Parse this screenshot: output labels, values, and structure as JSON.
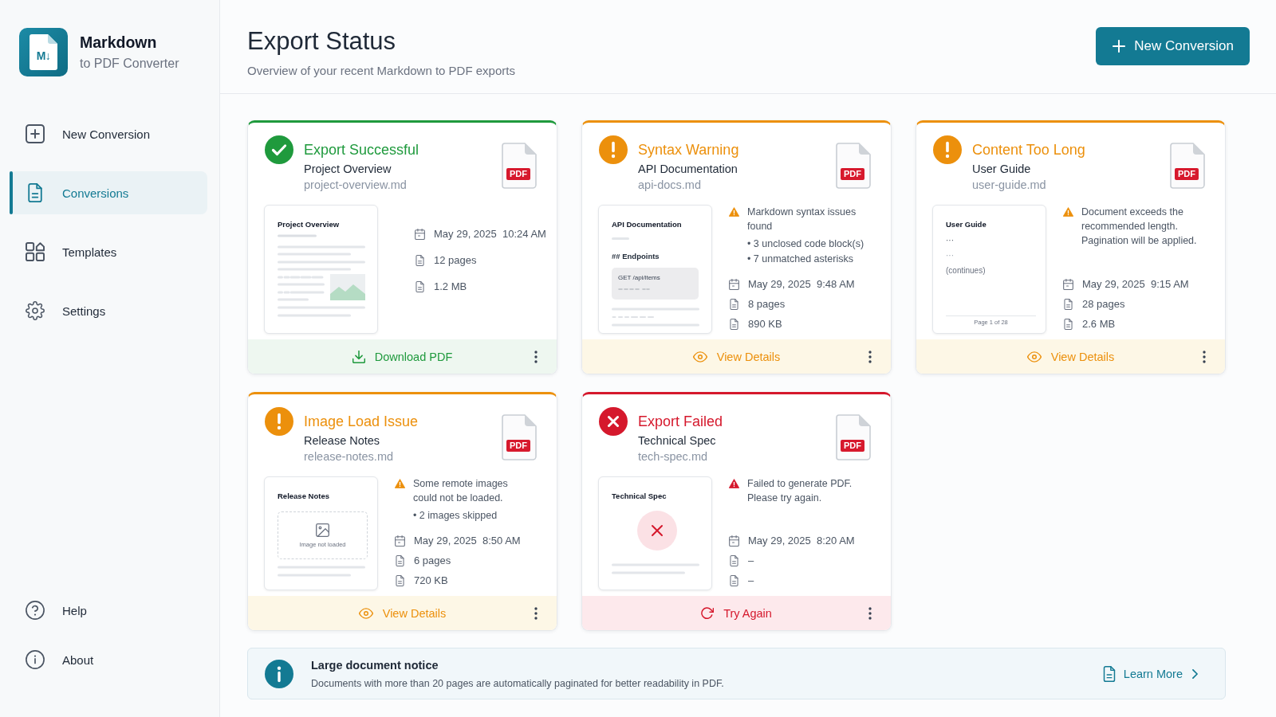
{
  "sidebar": {
    "logo_mark": "M↓",
    "app_title": "Markdown",
    "app_subtitle": "to PDF Converter",
    "nav_items": [
      {
        "label": "New Conversion",
        "selected": false
      },
      {
        "label": "Conversions",
        "selected": true
      },
      {
        "label": "Templates",
        "selected": false
      },
      {
        "label": "Settings",
        "selected": false
      }
    ],
    "footer_items": [
      {
        "label": "Help"
      },
      {
        "label": "About"
      }
    ]
  },
  "header": {
    "title": "Export Status",
    "subtitle": "Overview of your recent Markdown to PDF exports",
    "new_button": "New Conversion"
  },
  "cards": [
    {
      "kind": "success",
      "status": "Export Successful",
      "document": "Project Overview",
      "file": "project-overview.md",
      "file_type": "PDF",
      "preview": {
        "kind": "article",
        "title": "Project Overview"
      },
      "meta": {
        "date": "May 29, 2025  10:24 AM",
        "pages": "12 pages",
        "size": "1.2 MB"
      },
      "action": "Download PDF"
    },
    {
      "kind": "warning",
      "status": "Syntax Warning",
      "document": "API Documentation",
      "file": "api-docs.md",
      "file_type": "PDF",
      "preview": {
        "kind": "code",
        "title": "API Documentation",
        "heading": "## Endpoints",
        "code": "GET /api/items"
      },
      "message": {
        "text": "Markdown syntax issues found",
        "bullets": [
          "• 3 unclosed code block(s)",
          "• 7 unmatched asterisks"
        ]
      },
      "meta": {
        "date": "May 29, 2025  9:48 AM",
        "pages": "8 pages",
        "size": "890 KB"
      },
      "action": "View Details"
    },
    {
      "kind": "warning",
      "status": "Content Too Long",
      "document": "User Guide",
      "file": "user-guide.md",
      "file_type": "PDF",
      "preview": {
        "kind": "long",
        "title": "User Guide",
        "lines": [
          "···",
          "···",
          "(continues)"
        ],
        "page_label": "Page 1 of 28"
      },
      "message": {
        "text": "Document exceeds the recommended length. Pagination will be applied."
      },
      "meta": {
        "date": "May 29, 2025  9:15 AM",
        "pages": "28 pages",
        "size": "2.6 MB"
      },
      "action": "View Details"
    },
    {
      "kind": "warning",
      "status": "Image Load Issue",
      "document": "Release Notes",
      "file": "release-notes.md",
      "file_type": "PDF",
      "preview": {
        "kind": "missing_image",
        "title": "Release Notes",
        "caption": "Image not loaded"
      },
      "message": {
        "text": "Some remote images could not be loaded.",
        "bullets": [
          "• 2 images skipped"
        ]
      },
      "meta": {
        "date": "May 29, 2025  8:50 AM",
        "pages": "6 pages",
        "size": "720 KB"
      },
      "action": "View Details"
    },
    {
      "kind": "error",
      "status": "Export Failed",
      "document": "Technical Spec",
      "file": "tech-spec.md",
      "file_type": "PDF",
      "preview": {
        "kind": "failed",
        "title": "Technical Spec"
      },
      "message": {
        "text": "Failed to generate PDF. Please try again."
      },
      "meta": {
        "date": "May 29, 2025  8:20 AM",
        "pages": "–",
        "size": "–"
      },
      "action": "Try Again"
    }
  ],
  "notice": {
    "title": "Large document notice",
    "text": "Documents with more than 20 pages are automatically paginated for better readability in PDF.",
    "link": "Learn More"
  }
}
